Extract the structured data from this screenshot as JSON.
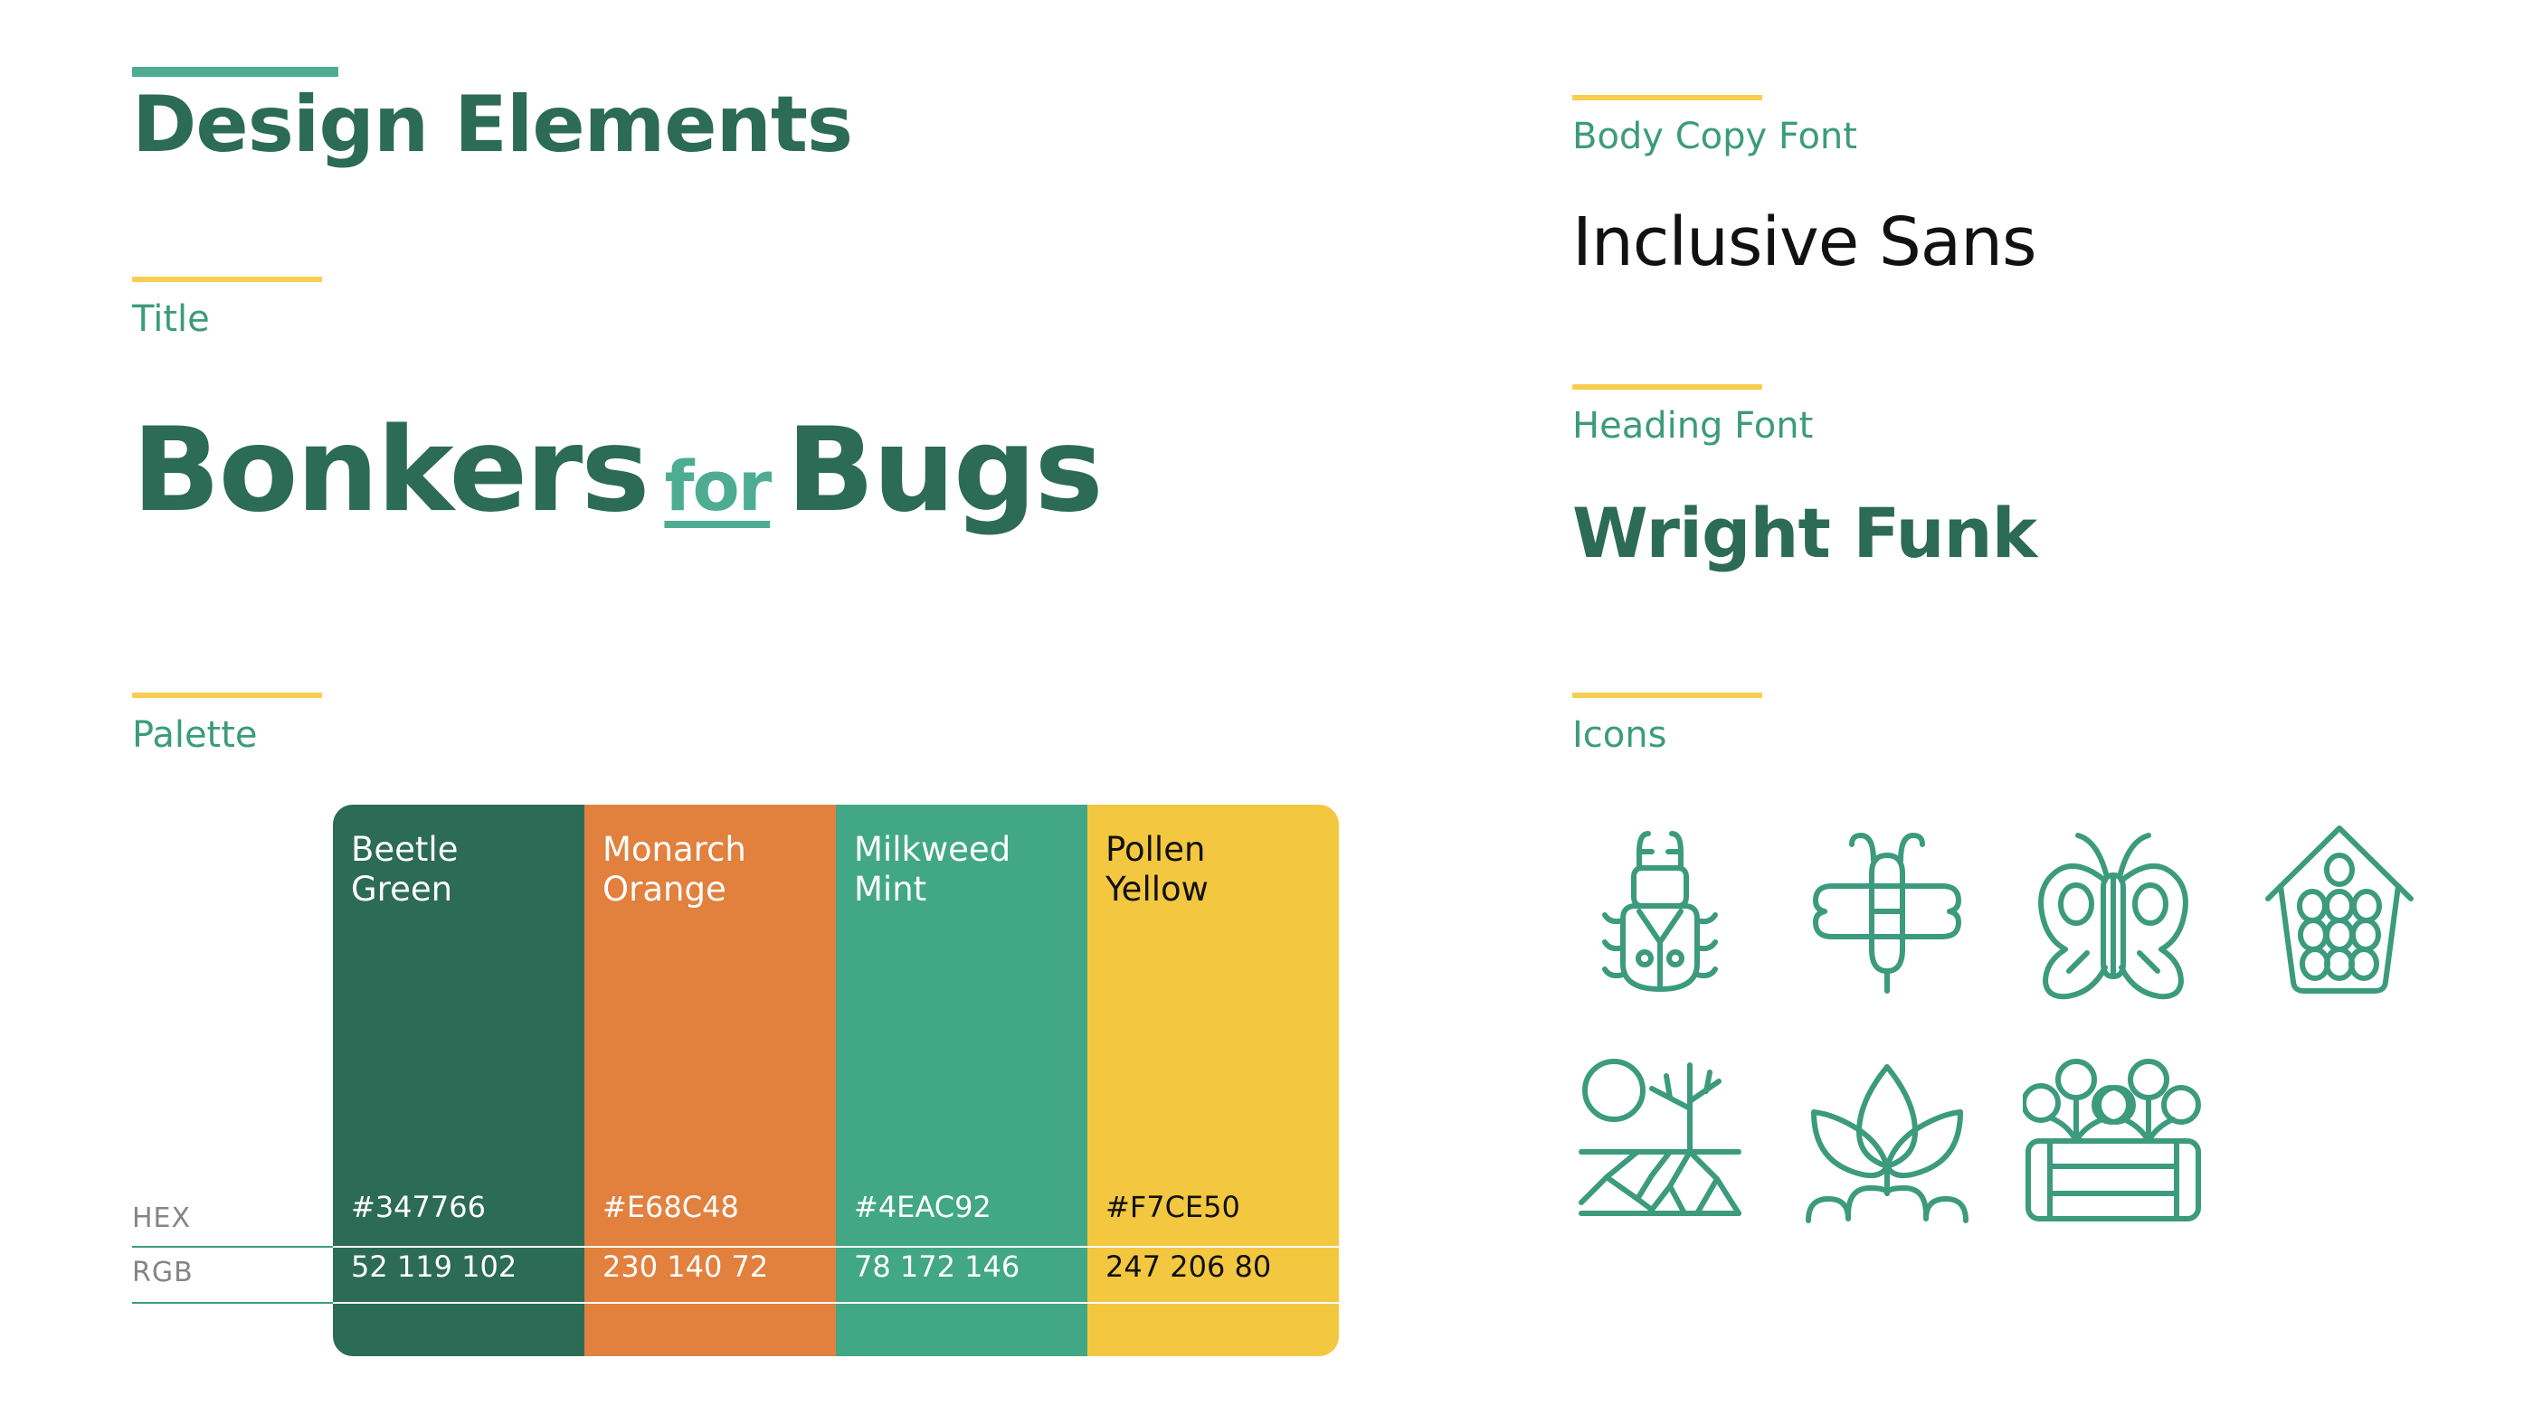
{
  "deck": {
    "title": "Design Elements"
  },
  "sections": {
    "title_label": "Title",
    "palette_label": "Palette",
    "body_copy_label": "Body Copy Font",
    "heading_label": "Heading Font",
    "icons_label": "Icons"
  },
  "brand": {
    "word1": "Bonkers",
    "connector": "for",
    "word2": "Bugs"
  },
  "fonts": {
    "body_copy_sample": "Inclusive Sans",
    "heading_sample": "Wright Funk"
  },
  "palette": {
    "row_labels": [
      "HEX",
      "RGB"
    ],
    "swatches": [
      {
        "name": "Beetle\nGreen",
        "hex": "#347766",
        "rgb": "52 119 102",
        "bg": "#2C6B56",
        "text": "#FFFFFF"
      },
      {
        "name": "Monarch\nOrange",
        "hex": "#E68C48",
        "rgb": "230 140 72",
        "bg": "#E2803E",
        "text": "#FFFFFF"
      },
      {
        "name": "Milkweed\nMint",
        "hex": "#4EAC92",
        "rgb": "78 172 146",
        "bg": "#41A785",
        "text": "#FFFFFF"
      },
      {
        "name": "Pollen\nYellow",
        "hex": "#F7CE50",
        "rgb": "247 206 80",
        "bg": "#F3C73F",
        "text": "#111111"
      }
    ]
  },
  "icons": [
    {
      "id": "beetle-icon",
      "label": "Beetle"
    },
    {
      "id": "bee-icon",
      "label": "Bee"
    },
    {
      "id": "butterfly-icon",
      "label": "Butterfly"
    },
    {
      "id": "bee-house-icon",
      "label": "Bee House"
    },
    {
      "id": "tree-roots-icon",
      "label": "Tree With Roots"
    },
    {
      "id": "sprout-icon",
      "label": "Sprout"
    },
    {
      "id": "planter-box-icon",
      "label": "Planter Box"
    }
  ],
  "colors": {
    "beetle_green": "#347766",
    "monarch_orange": "#E68C48",
    "milkweed_mint": "#4EAC92",
    "pollen_yellow": "#F7CE50",
    "icon_stroke": "#3C9B7C",
    "label_gray": "#858585"
  }
}
